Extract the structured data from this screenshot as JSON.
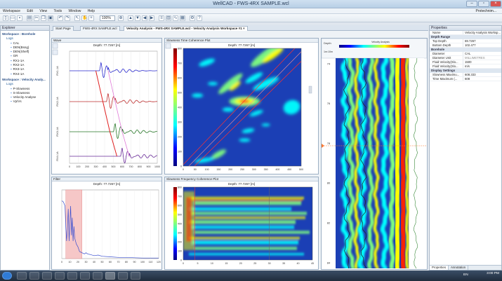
{
  "app": {
    "title": "WellCAD - FWS-4RX SAMPLE.wcl",
    "user": "Protechnim..."
  },
  "menu": [
    "Workspace",
    "Edit",
    "View",
    "Tools",
    "Window",
    "Help"
  ],
  "toolbar": {
    "zoom": "100%"
  },
  "tabs": [
    {
      "label": "Start Page"
    },
    {
      "label": "FWS-4RX SAMPLE.wcl"
    },
    {
      "label": "Velocity Analysis - FWS-4RX SAMPLE.wcl - Velocity Analysis Workspace #1"
    }
  ],
  "explorer": {
    "title": "Explorer",
    "workspace1": "Workspace : Borehole",
    "group1": "Logs",
    "logs1": [
      "CAL",
      "DEN(Bsng)",
      "DEN(Shelf)",
      "GR",
      "RX1-1A",
      "RX2-1A",
      "RX3-1A",
      "RX4-1A"
    ],
    "workspace2": "Workspace : Velocity Analy...",
    "group2": "Logs",
    "logs2": [
      "P-Slowness",
      "S-Slowness",
      "Velocity Analyse",
      "Vp/Vs"
    ]
  },
  "panels": {
    "wave": {
      "header": "Wave",
      "depth": "Depth: 77.7267 [m]",
      "traces": [
        "RX1-1A",
        "RX2-1A",
        "RX3-1A",
        "RX4-1A"
      ],
      "xticks": [
        "0",
        "100",
        "200",
        "300",
        "400",
        "500",
        "600",
        "700",
        "800",
        "900",
        "1000"
      ]
    },
    "stc": {
      "header": "Slowness Time Coherence Plot",
      "depth": "Depth: 77.7267 [m]",
      "yticks": [
        "800",
        "700",
        "600",
        "500",
        "400",
        "300",
        "200",
        "100",
        "0"
      ],
      "xticks": [
        "0",
        "50",
        "100",
        "150",
        "200",
        "250",
        "300",
        "350",
        "400",
        "450",
        "500"
      ]
    },
    "filter": {
      "header": "Filter",
      "depth": "Depth: 77.7267 [m]",
      "xticks": [
        "0",
        "10",
        "20",
        "30",
        "40",
        "50",
        "60",
        "70",
        "80",
        "90",
        "100",
        "110",
        "120"
      ]
    },
    "sfc": {
      "header": "Slowness Frequency Coherence Plot",
      "depth": "Depth: 77.7267 [m]",
      "yticks": [
        "800",
        "700",
        "600",
        "500",
        "400",
        "300",
        "200",
        "100",
        "0"
      ],
      "xticks": [
        "0",
        "5",
        "10",
        "15",
        "20",
        "25",
        "30",
        "35",
        "40",
        "45"
      ]
    },
    "log": {
      "header_depth": "Depth",
      "header_scale": "1m:10m",
      "track_title": "Velocity Analysis",
      "depth_ticks": [
        "74",
        "76",
        "78",
        "80",
        "82",
        "84"
      ]
    }
  },
  "properties": {
    "title": "Properties",
    "name_label": "Name",
    "name_value": "Velocity Analysis Worksp...",
    "sections": [
      {
        "title": "Depth Range",
        "rows": [
          {
            "k": "Top Depth",
            "v": "69.7267"
          },
          {
            "k": "Bottom Depth",
            "v": "102.477"
          }
        ]
      },
      {
        "title": "Borehole",
        "rows": [
          {
            "k": "Diameter",
            "v": "CAL"
          },
          {
            "k": "Diameter Unit",
            "v": "MILLIMETRES"
          },
          {
            "k": "Fluid Velocity(Slo...",
            "v": "1500"
          },
          {
            "k": "Fluid Velocity(Slo...",
            "v": "m/s"
          }
        ]
      },
      {
        "title": "Display Settings",
        "rows": [
          {
            "k": "Slowness Maximu...",
            "v": "608.333"
          },
          {
            "k": "Time Maximum (...",
            "v": "608"
          }
        ]
      }
    ],
    "bottom_tabs": [
      "Properties",
      "Annotation"
    ]
  },
  "taskbar": {
    "time": "3:00 PM",
    "lang": "EN"
  },
  "colors": {
    "accent": "#3b7bd6",
    "trace1": "#2b2bd0",
    "trace2": "#c03030",
    "trace3": "#2a7a2a",
    "trace4": "#6a2b9a",
    "move_red": "#e02020",
    "move_pink": "#e07bd8"
  }
}
